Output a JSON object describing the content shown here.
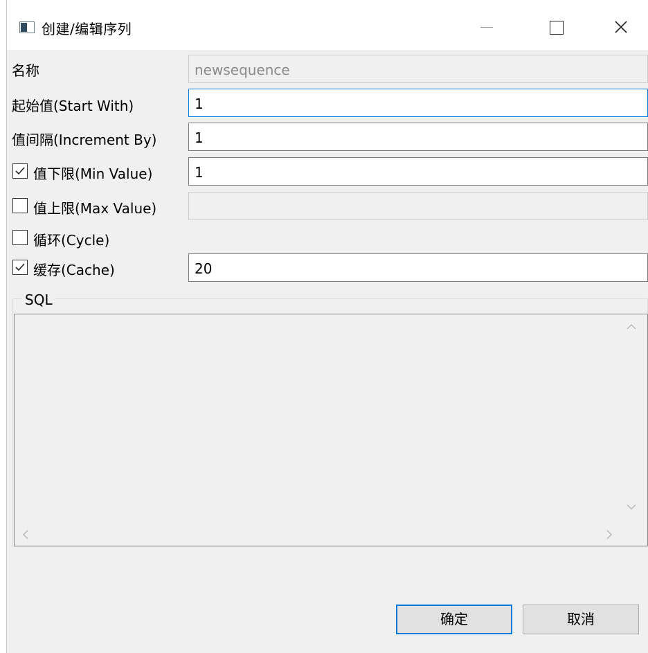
{
  "window": {
    "title": "创建/编辑序列",
    "icon": "window-app-icon",
    "controls": [
      "minimize-icon",
      "maximize-icon",
      "close-icon"
    ]
  },
  "form": {
    "name": {
      "label": "名称",
      "value": "newsequence",
      "disabled": true
    },
    "start_with": {
      "label": "起始值(Start With)",
      "value": "1",
      "focused": true
    },
    "increment_by": {
      "label": "值间隔(Increment By)",
      "value": "1"
    },
    "min_value": {
      "label": "值下限(Min Value)",
      "checked": true,
      "value": "1"
    },
    "max_value": {
      "label": "值上限(Max Value)",
      "checked": false,
      "value": ""
    },
    "cycle": {
      "label": "循环(Cycle)",
      "checked": false
    },
    "cache": {
      "label": "缓存(Cache)",
      "checked": true,
      "value": "20"
    }
  },
  "sql_group": {
    "title": "SQL",
    "content": ""
  },
  "buttons": {
    "ok": "确定",
    "cancel": "取消"
  },
  "colors": {
    "accent": "#0078d7",
    "dialog_bg": "#f0f0f0",
    "button_bg": "#e1e1e1"
  }
}
